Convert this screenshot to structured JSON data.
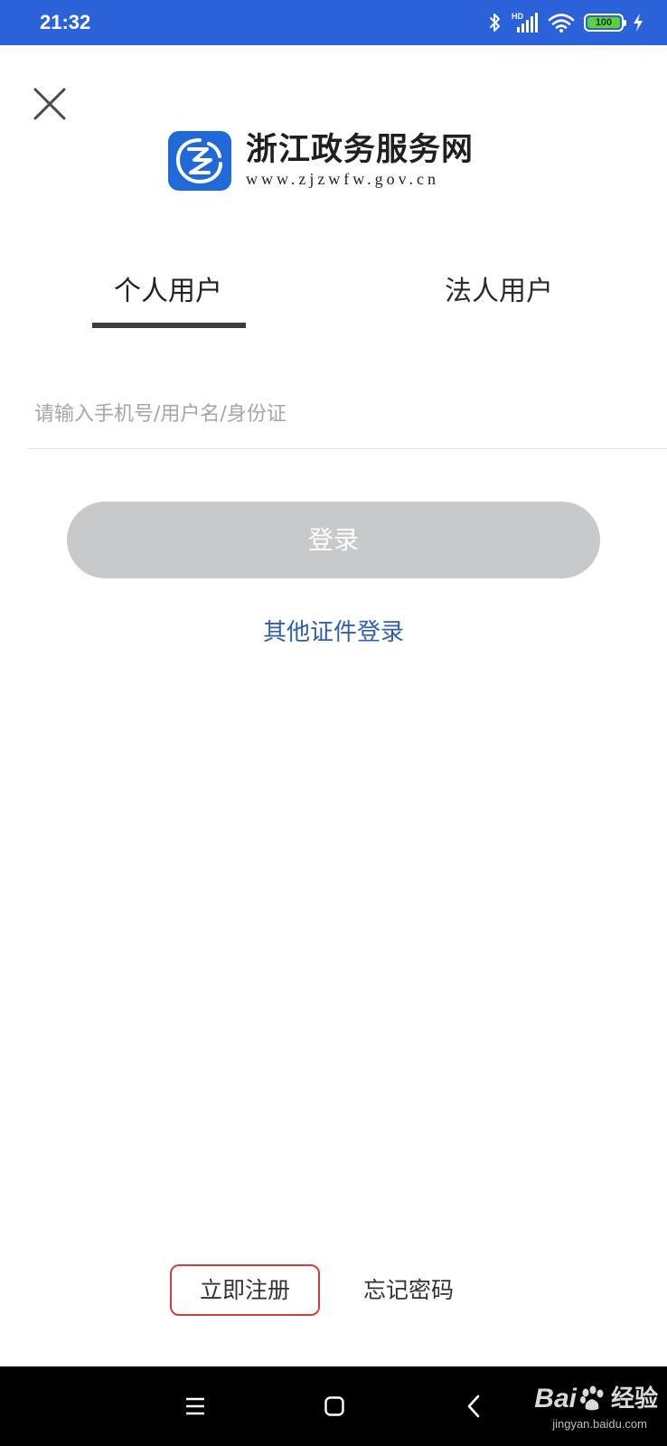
{
  "status_bar": {
    "time": "21:32",
    "battery": "100",
    "network_label": "HD",
    "background": "#2c62d9"
  },
  "header": {
    "close_icon": "close-icon"
  },
  "logo": {
    "title": "浙江政务服务网",
    "url": "www.zjzwfw.gov.cn",
    "emblem_color": "#2168d8"
  },
  "tabs": [
    {
      "label": "个人用户",
      "active": true
    },
    {
      "label": "法人用户",
      "active": false
    }
  ],
  "account_input": {
    "placeholder": "请输入手机号/用户名/身份证",
    "value": ""
  },
  "login_button": {
    "label": "登录",
    "enabled": false,
    "color": "#c8c9cb"
  },
  "other_login": {
    "label": "其他证件登录",
    "color": "#2d5fae"
  },
  "footer_links": {
    "register_label": "立即注册",
    "register_highlight_color": "#d63c3c",
    "forgot_label": "忘记密码"
  },
  "nav_bar": {
    "menu_icon": "menu-icon",
    "home_icon": "home-icon",
    "back_icon": "back-icon"
  },
  "watermark": {
    "brand": "Bai",
    "brand_suffix": "经验",
    "url": "jingyan.baidu.com"
  }
}
